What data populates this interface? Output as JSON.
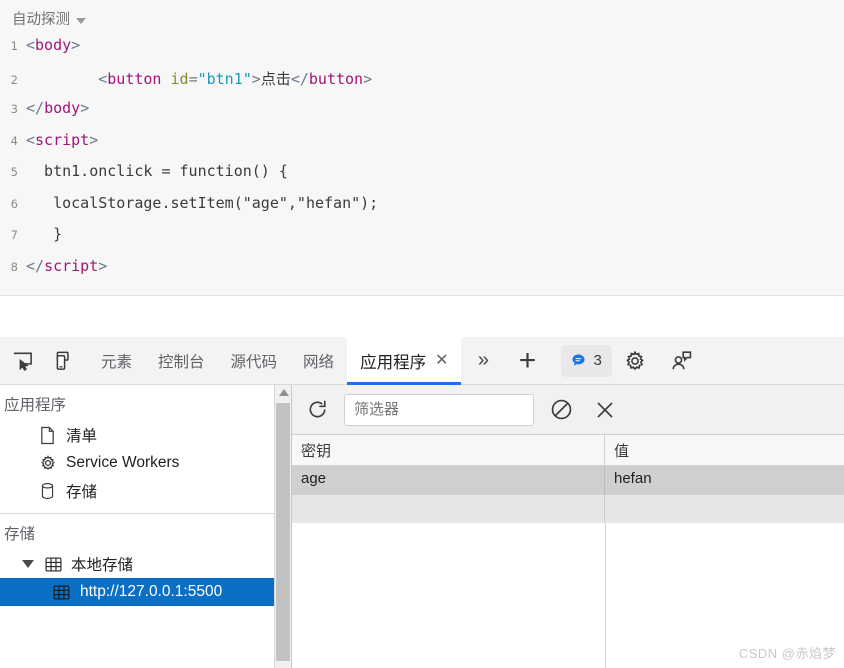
{
  "editor": {
    "language_selector": "自动探测",
    "lines": [
      {
        "n": "1",
        "tokens": [
          {
            "t": "punc",
            "s": "<"
          },
          {
            "t": "tag",
            "s": "body"
          },
          {
            "t": "punc",
            "s": ">"
          }
        ]
      },
      {
        "n": "2",
        "tokens": [
          {
            "t": "plain",
            "s": "        "
          },
          {
            "t": "punc",
            "s": "<"
          },
          {
            "t": "tag",
            "s": "button"
          },
          {
            "t": "plain",
            "s": " "
          },
          {
            "t": "attr",
            "s": "id"
          },
          {
            "t": "punc",
            "s": "="
          },
          {
            "t": "val",
            "s": "\"btn1\""
          },
          {
            "t": "punc",
            "s": ">"
          },
          {
            "t": "plain",
            "s": "点击"
          },
          {
            "t": "punc",
            "s": "</"
          },
          {
            "t": "tag",
            "s": "button"
          },
          {
            "t": "punc",
            "s": ">"
          }
        ]
      },
      {
        "n": "3",
        "tokens": [
          {
            "t": "punc",
            "s": "</"
          },
          {
            "t": "tag",
            "s": "body"
          },
          {
            "t": "punc",
            "s": ">"
          }
        ]
      },
      {
        "n": "4",
        "tokens": [
          {
            "t": "punc",
            "s": "<"
          },
          {
            "t": "tag",
            "s": "script"
          },
          {
            "t": "punc",
            "s": ">"
          }
        ]
      },
      {
        "n": "5",
        "tokens": [
          {
            "t": "plain",
            "s": "  btn1.onclick = function() {"
          }
        ]
      },
      {
        "n": "6",
        "tokens": [
          {
            "t": "plain",
            "s": "   localStorage.setItem(\"age\",\"hefan\");"
          }
        ]
      },
      {
        "n": "7",
        "tokens": [
          {
            "t": "plain",
            "s": "   }"
          }
        ]
      },
      {
        "n": "8",
        "tokens": [
          {
            "t": "punc",
            "s": "</"
          },
          {
            "t": "tag",
            "s": "script"
          },
          {
            "t": "punc",
            "s": ">"
          }
        ]
      }
    ]
  },
  "devtools": {
    "tabs": [
      {
        "label": "元素",
        "active": false,
        "closable": false
      },
      {
        "label": "控制台",
        "active": false,
        "closable": false
      },
      {
        "label": "源代码",
        "active": false,
        "closable": false
      },
      {
        "label": "网络",
        "active": false,
        "closable": false
      },
      {
        "label": "应用程序",
        "active": true,
        "closable": true
      }
    ],
    "tab_close_glyph": "✕",
    "more_tabs_glyph": "»",
    "add_tab_glyph": "+",
    "issues_count": "3",
    "accent_color": "#1a73e8"
  },
  "sidebar": {
    "application": {
      "title": "应用程序",
      "items": [
        {
          "label": "清单",
          "icon": "manifest-file-icon"
        },
        {
          "label": "Service Workers",
          "icon": "gear-icon"
        },
        {
          "label": "存储",
          "icon": "database-icon"
        }
      ]
    },
    "storage": {
      "title": "存储",
      "group_label": "本地存储",
      "group_icon": "table-grid-icon",
      "origin_label": "http://127.0.0.1:5500",
      "origin_icon": "table-grid-icon",
      "selected_color": "#0b6fc4"
    }
  },
  "storage_panel": {
    "toolbar": {
      "refresh_icon": "refresh-icon",
      "filter_placeholder": "筛选器",
      "filter_value": "",
      "clear_all_icon": "no-entry-icon",
      "delete_selected_icon": "close-x-icon"
    },
    "table": {
      "columns": [
        "密钥",
        "值"
      ],
      "rows": [
        {
          "key": "age",
          "value": "hefan"
        }
      ],
      "empty_rows": 1
    }
  },
  "watermark": "CSDN @赤焰梦"
}
